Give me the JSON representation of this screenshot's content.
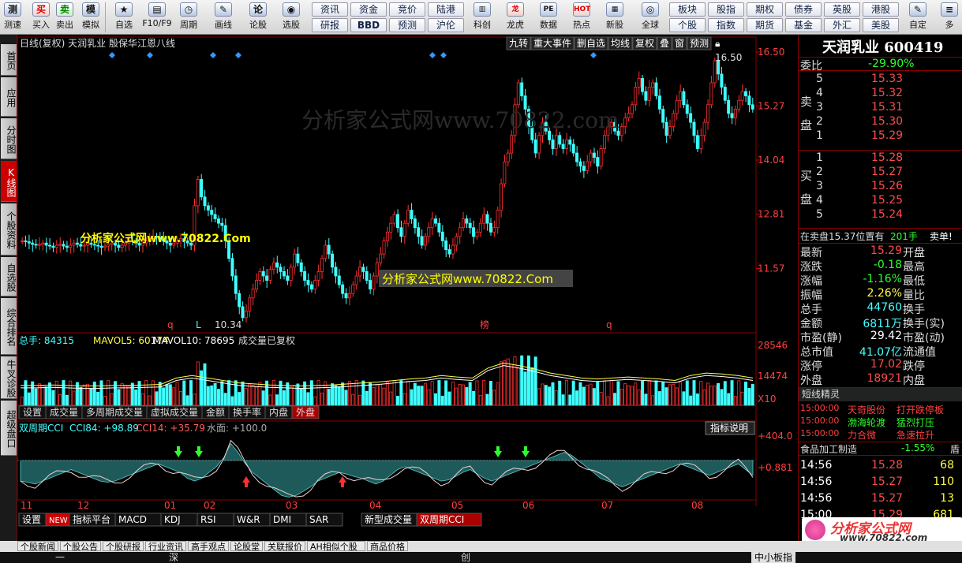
{
  "toolbar": {
    "left": [
      [
        "测速",
        "speed-test-button"
      ],
      [
        "买入",
        "buy-button"
      ],
      [
        "卖出",
        "sell-button"
      ],
      [
        "模拟",
        "simulate-button"
      ]
    ],
    "groups": [
      [
        "自选",
        "watchlist-button"
      ],
      [
        "F10/F9",
        "f10-button"
      ],
      [
        "周期",
        "period-button"
      ],
      [
        "画线",
        "draw-line-button"
      ],
      [
        "论股",
        "discuss-stock-button"
      ],
      [
        "选股",
        "stock-picker-button"
      ]
    ],
    "grid": [
      [
        "资讯",
        "资金",
        "竞价",
        "陆港"
      ],
      [
        "研报",
        "BBD",
        "预测",
        "沪伦"
      ]
    ],
    "apps": [
      [
        "科创",
        "star-board-button"
      ],
      [
        "龙虎",
        "dragon-tiger-button"
      ],
      [
        "数据",
        "data-button"
      ],
      [
        "热点",
        "hotspot-button"
      ],
      [
        "新股",
        "new-stock-button"
      ]
    ],
    "grid2": [
      [
        "板块",
        "股指",
        "期权",
        "债券",
        "英股",
        "港股"
      ],
      [
        "个股",
        "指数",
        "期货",
        "基金",
        "外汇",
        "美股"
      ]
    ],
    "globe": "全球",
    "right": [
      "自定",
      "多"
    ]
  },
  "lefttabs": [
    [
      "首页",
      "home"
    ],
    [
      "应用",
      "apps"
    ],
    [
      "分时图",
      "intraday"
    ],
    [
      "K线图",
      "kline"
    ],
    [
      "个股资料",
      "profile"
    ],
    [
      "自选股",
      "my-stocks"
    ],
    [
      "综合排名",
      "ranking"
    ],
    [
      "牛叉诊股",
      "diagnosis"
    ],
    [
      "超级盘口",
      "super-quote"
    ]
  ],
  "chart": {
    "title": "日线(复权) 天润乳业 殷保华江恩八线",
    "tools": [
      "九转",
      "重大事件",
      "删自选",
      "均线",
      "复权",
      "叠",
      "窗",
      "预测"
    ],
    "price_ticks": [
      "16.50",
      "15.27",
      "14.04",
      "12.81",
      "11.57"
    ],
    "high_label": "16.50",
    "low_label": "10.34",
    "markers": [
      "q",
      "L",
      "榜",
      "q"
    ],
    "vol_legend": {
      "total": "总手: 84315",
      "ma5": "MAVOL5: 60174",
      "ma10": "MAVOL10: 78695",
      "note": "成交量已复权"
    },
    "vol_ticks": [
      "28546",
      "14474",
      "X10"
    ],
    "vol_tabs": [
      "设置",
      "成交量",
      "多周期成交量",
      "虚拟成交量",
      "金额",
      "换手率",
      "内盘",
      "外盘"
    ],
    "cci_legend": {
      "name": "双周期CCI",
      "cci84": "CCI84: +98.89",
      "cci14": "CCI14: +35.79",
      "water": "水面: +100.0"
    },
    "cci_help": "指标说明",
    "cci_ticks": [
      "+404.0",
      "+0.881"
    ],
    "months": [
      "11",
      "12",
      "01",
      "02",
      "03",
      "04",
      "05",
      "06",
      "07",
      "08"
    ],
    "ind_tabs": [
      "设置",
      "NEW",
      "指标平台",
      "MACD",
      "KDJ",
      "RSI",
      "W&R",
      "DMI",
      "SAR",
      "新型成交量",
      "双周期CCI"
    ],
    "watermark": "分析家公式网www.70822.com",
    "watermark2": "分析家公式网www.70822.Com",
    "watermark3": "分析家公式网www.70822.Com"
  },
  "chart_data": {
    "type": "candlestick",
    "title": "日线(复权) 天润乳业",
    "ylim": [
      10.34,
      16.5
    ],
    "price": [
      12.2,
      12.18,
      12.15,
      12.12,
      12.1,
      12.12,
      12.15,
      12.1,
      12.08,
      12.05,
      12.1,
      12.12,
      12.08,
      12.05,
      12.1,
      12.15,
      12.12,
      12.08,
      12.1,
      12.15,
      12.12,
      12.1,
      12.08,
      12.05,
      12.08,
      12.12,
      12.15,
      12.1,
      12.05,
      12.1,
      12.15,
      12.2,
      12.18,
      12.15,
      12.1,
      12.15,
      12.2,
      12.25,
      12.3,
      12.28,
      12.25,
      12.2,
      12.15,
      12.1,
      12.15,
      12.2,
      12.25,
      12.2,
      12.15,
      12.1,
      13.0,
      13.6,
      13.2,
      13.0,
      12.9,
      12.8,
      12.7,
      12.6,
      12.55,
      12.2,
      11.8,
      11.4,
      11.0,
      10.7,
      10.45,
      10.6,
      10.9,
      11.1,
      11.3,
      11.5,
      11.4,
      11.3,
      11.55,
      11.7,
      11.6,
      11.5,
      11.4,
      11.3,
      11.6,
      11.9,
      11.7,
      11.5,
      11.3,
      11.2,
      11.1,
      11.3,
      11.5,
      11.8,
      12.1,
      11.9,
      11.6,
      11.4,
      11.2,
      11.0,
      10.9,
      11.0,
      11.2,
      11.4,
      11.6,
      11.5,
      11.3,
      11.1,
      11.4,
      11.7,
      11.9,
      12.2,
      12.4,
      12.6,
      12.8,
      12.5,
      12.3,
      12.6,
      12.9,
      12.7,
      12.5,
      12.3,
      12.1,
      12.3,
      12.5,
      12.7,
      12.6,
      12.4,
      12.2,
      12.0,
      11.9,
      12.1,
      12.3,
      12.5,
      12.7,
      12.6,
      12.5,
      12.3,
      12.4,
      12.6,
      12.8,
      12.6,
      12.4,
      12.5,
      12.9,
      13.5,
      14.0,
      14.2,
      14.6,
      15.3,
      15.8,
      15.5,
      15.2,
      14.8,
      14.5,
      14.2,
      14.6,
      14.9,
      14.7,
      14.5,
      14.3,
      14.6,
      14.4,
      14.3,
      14.5,
      14.4,
      14.2,
      14.0,
      13.9,
      13.8,
      14.0,
      14.2,
      14.1,
      13.9,
      14.3,
      14.6,
      14.8,
      14.9,
      14.7,
      14.6,
      14.8,
      15.0,
      15.1,
      15.3,
      15.7,
      15.9,
      15.6,
      15.4,
      15.7,
      15.8,
      15.5,
      15.2,
      14.9,
      14.6,
      14.8,
      15.1,
      15.4,
      15.6,
      15.3,
      15.1,
      14.9,
      14.6,
      14.3,
      14.6,
      14.9,
      15.3,
      15.8,
      16.3,
      16.0,
      15.7,
      15.4,
      15.1,
      15.0,
      15.2,
      15.4,
      15.6,
      15.5,
      15.3,
      15.2
    ],
    "vol_ma": [
      0.35,
      0.35,
      0.36,
      0.35,
      0.34,
      0.34,
      0.35,
      0.35,
      0.36,
      0.37,
      0.5,
      0.55,
      0.5,
      0.45,
      0.4,
      0.38,
      0.36,
      0.35,
      0.34,
      0.35,
      0.36,
      0.38,
      0.4,
      0.42,
      0.45,
      0.48,
      0.5,
      0.55,
      0.52,
      0.5,
      0.7,
      0.8,
      0.75,
      0.68,
      0.6,
      0.55,
      0.5,
      0.48,
      0.5,
      0.52,
      0.5,
      0.48,
      0.45,
      0.55,
      0.6,
      0.58,
      0.55,
      0.5
    ],
    "cci": [
      0.3,
      0.28,
      0.25,
      0.3,
      0.35,
      0.4,
      0.45,
      0.5,
      0.45,
      0.4,
      0.35,
      0.3,
      0.28,
      0.3,
      0.35,
      0.4,
      0.45,
      0.5,
      0.55,
      0.6,
      0.55,
      0.5,
      0.45,
      0.35,
      0.3,
      0.35,
      0.45,
      0.55,
      0.7,
      0.95,
      0.8,
      0.6,
      0.45,
      0.35,
      0.25,
      0.15,
      0.05,
      0.02,
      0.05,
      0.12,
      0.2,
      0.3,
      0.35,
      0.4,
      0.45,
      0.42,
      0.38,
      0.35,
      0.3,
      0.25,
      0.3,
      0.4,
      0.5,
      0.55,
      0.5,
      0.45,
      0.4,
      0.35,
      0.3,
      0.32,
      0.38,
      0.45,
      0.5,
      0.42,
      0.35,
      0.3,
      0.35,
      0.4,
      0.45,
      0.5,
      0.55,
      0.6,
      0.65,
      0.7,
      0.75,
      0.8,
      0.75,
      0.65,
      0.55,
      0.45,
      0.35,
      0.3,
      0.25,
      0.2,
      0.25,
      0.3,
      0.35,
      0.4,
      0.45,
      0.5,
      0.55,
      0.6,
      0.55,
      0.5,
      0.45,
      0.4,
      0.45,
      0.5,
      0.55,
      0.6,
      0.5,
      0.4
    ]
  },
  "quote": {
    "name": "天润乳业 600419",
    "weibi_l": "委比",
    "weibi_v": "-29.90%",
    "sell_label": [
      "卖",
      "盘"
    ],
    "buy_label": [
      "买",
      "盘"
    ],
    "sell": [
      [
        "5",
        "15.33"
      ],
      [
        "4",
        "15.32"
      ],
      [
        "3",
        "15.31"
      ],
      [
        "2",
        "15.30"
      ],
      [
        "1",
        "15.29"
      ]
    ],
    "buy": [
      [
        "1",
        "15.28"
      ],
      [
        "2",
        "15.27"
      ],
      [
        "3",
        "15.26"
      ],
      [
        "4",
        "15.25"
      ],
      [
        "5",
        "15.24"
      ]
    ],
    "alert": "在卖盘15.37位置有",
    "alert_v": "201手",
    "alert_e": "卖单!",
    "stats": [
      [
        "最新",
        "15.29",
        "开盘"
      ],
      [
        "涨跌",
        "-0.18",
        "最高"
      ],
      [
        "涨幅",
        "-1.16%",
        "最低"
      ],
      [
        "振幅",
        "2.26%",
        "量比"
      ],
      [
        "总手",
        "44760",
        "换手"
      ],
      [
        "金额",
        "6811万",
        "换手(实)"
      ],
      [
        "市盈(静)",
        "29.42",
        "市盈(动)"
      ],
      [
        "总市值",
        "41.07亿",
        "流通值"
      ],
      [
        "涨停",
        "17.02",
        "跌停"
      ],
      [
        "外盘",
        "18921",
        "内盘"
      ]
    ],
    "news_title": "短线精灵",
    "news": [
      [
        "15:00:00",
        "天奇股份",
        "打开跌停板"
      ],
      [
        "15:00:00",
        "渤海轮渡",
        "猛烈打压"
      ],
      [
        "15:00:00",
        "力合微",
        "急速拉升"
      ]
    ],
    "sector": "食品加工制造",
    "sector_v": "-1.55%",
    "sector_e": "盾",
    "ticks": [
      [
        "14:56",
        "15.28",
        "68"
      ],
      [
        "14:56",
        "15.27",
        "110"
      ],
      [
        "14:56",
        "15.27",
        "13"
      ],
      [
        "15:00",
        "15.29",
        "681"
      ]
    ]
  },
  "bottom": {
    "tabs": [
      "个股新闻",
      "个股公告",
      "个股研报",
      "行业资讯",
      "高手观点",
      "论股堂",
      "关联报价",
      "AH相似个股",
      "商品价格"
    ],
    "status": [
      "一",
      "深",
      "创",
      "中小板指"
    ],
    "logo": "分析家公式网",
    "logo_url": "www.70822.com"
  }
}
